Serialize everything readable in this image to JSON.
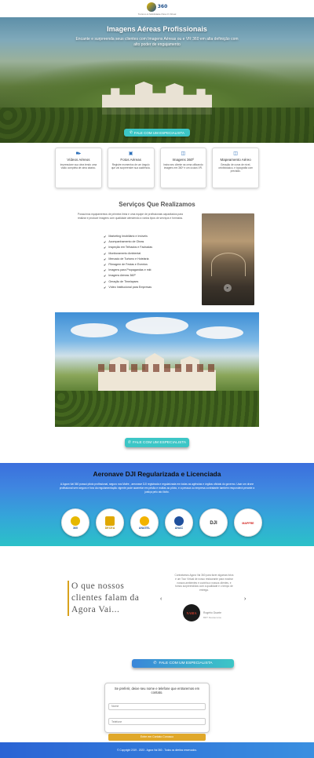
{
  "header": {
    "logo_text": "360",
    "tagline": "Turismo & Mobilidade Para O Virtual"
  },
  "hero": {
    "title": "Imagens Aéreas Profissionais",
    "subtitle": "Encante e surpreenda seus clientes com Imagens Aéreas ou e VR 360 em alta definição com alto poder de engajamento",
    "cta": "FALE COM UM ESPECIALISTA"
  },
  "features": [
    {
      "icon": "video-camera-icon",
      "title": "Vídeos Aéreos",
      "desc": "Impressione sua obra tendo uma visão completa de cima abaixo."
    },
    {
      "icon": "image-icon",
      "title": "Fotos Aéreas",
      "desc": "Registre momentos de um ângulo que vai surpreender sua audiência."
    },
    {
      "icon": "vr-headset-icon",
      "title": "Imagens 360º",
      "desc": "Insira seu cliente na cena utilizando imagens em 360º e um óculos VR."
    },
    {
      "icon": "vr-headset-icon",
      "title": "Mapeamento Aéreo",
      "desc": "Geração de curva de nível, ortofotosaico, e topografia com precisão."
    }
  ],
  "services": {
    "title": "Serviços Que Realizamos",
    "intro": "Possuímos equipamentos de primeira linha e uma equipe de profissionais capacitados para realizar e produzir imagens com qualidade atendendo a vários tipos de serviços e formatos.",
    "items": [
      "Marketing Imobiliário e Imóveis",
      "Acompanhamento de Obras",
      "Inspeção em Telhados e Fachadas",
      "Monitoramento Ambiental",
      "Mercado de Turismo e Hotelaria",
      "Filmagem de Festas e Eventos",
      "Imagens para Propagandas e mkt",
      "Imagens Aéreas 360º",
      "Geração de Timelapses",
      "Vídeo Institucional para Empresas"
    ]
  },
  "mid_cta": "FALE COM UM ESPECIALISTA",
  "licensed": {
    "title": "Aeronave DJI Regularizada e Licenciada",
    "text": "A Agora Vai 360 possui piloto profissional, seguro nos Mafre , aeronave DJI registrada e regularizada em todas as agências e órgãos oficiais do governo. Usar um drone profissional sem seguro e fora da regulamentação vigente pode acarretar em prisão e multas ao piloto, e a pessoa ou empresa contratante também responderá perante a justiça pelo ato ilícito.",
    "badges": [
      {
        "label": "360",
        "color": "#1c4e8a"
      },
      {
        "label": "DECEA",
        "color": "#e0a800"
      },
      {
        "label": "ANATEL",
        "color": "#f2b300"
      },
      {
        "label": "ANAC",
        "color": "#1f4f9c"
      },
      {
        "label": "DJI",
        "color": "#333333"
      },
      {
        "label": "MAPFRE",
        "color": "#d2231e"
      }
    ]
  },
  "testimonials": {
    "heading": "O que nossos clientes falam da Agora Vai...",
    "quote": "Contratamos Agora Vai 360 para fazer algumas fotos e um Tour Virtual de nosso restaurante para mostrar nossos ambientes e cozinha a nossos clientes, e fomos surpreendidos com a qualidade e o tempo de entrega.",
    "avatar_text": "NABIA",
    "name": "Rogério Duarte",
    "role": "BRT Restaurante",
    "prev": "‹",
    "next": "›"
  },
  "low_cta": "FALE COM UM ESPECIALISTA",
  "form": {
    "intro": "Se preferir, deixe seu nome e telefone que entraremos em contato.",
    "name_placeholder": "Nome",
    "phone_placeholder": "Telefone",
    "submit": "Entre em Contato Conosco"
  },
  "footer": {
    "copyright": "© Copyright 2019 - 2023 - Agora Vai 360 - Todos os direitos reservados."
  },
  "colors": {
    "accent_cyan": "#3cc6c6",
    "brand_blue": "#2a6db8",
    "gold": "#e0a82a"
  }
}
